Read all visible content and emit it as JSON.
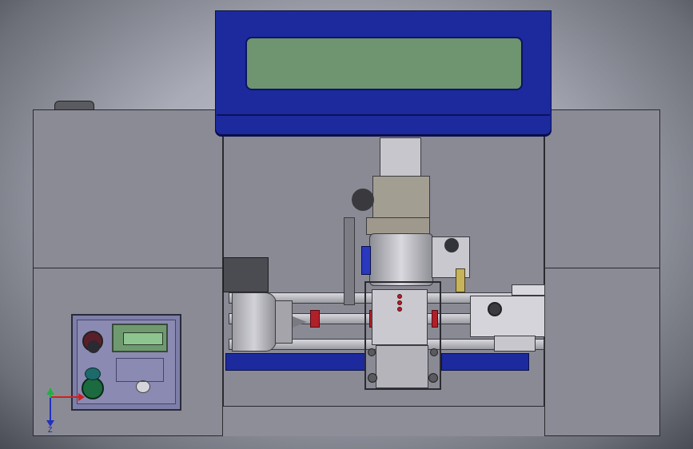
{
  "scene": {
    "background_color": "#a9abb6",
    "enclosure_color": "#8a8b95",
    "lcd_housing_color": "#1c2a9e",
    "lcd_screen_color": "#6e9470",
    "control_panel_color": "#7e7fa8",
    "rail_color": "#1c2a9e",
    "accent_color": "#b0202a"
  },
  "triad": {
    "x_axis_color": "#d02020",
    "y_axis_color": "#20b040",
    "z_axis_color": "#2030c0",
    "z_label": "Z"
  }
}
